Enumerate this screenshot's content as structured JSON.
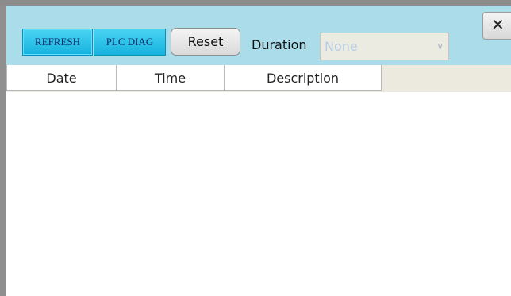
{
  "toolbar": {
    "refresh_label": "REFRESH",
    "plc_diag_label": "PLC DIAG",
    "reset_label": "Reset",
    "duration_label": "Duration",
    "duration_value": "None",
    "close_glyph": "✕"
  },
  "table": {
    "columns": [
      "Date",
      "Time",
      "Description"
    ],
    "rows": []
  },
  "colors": {
    "toolbar_bg": "#aadde9",
    "button_blue": "#1fb8e3",
    "header_fill": "#ece9df"
  },
  "icons": {
    "close": "close-icon",
    "dropdown": "chevron-down-icon"
  }
}
